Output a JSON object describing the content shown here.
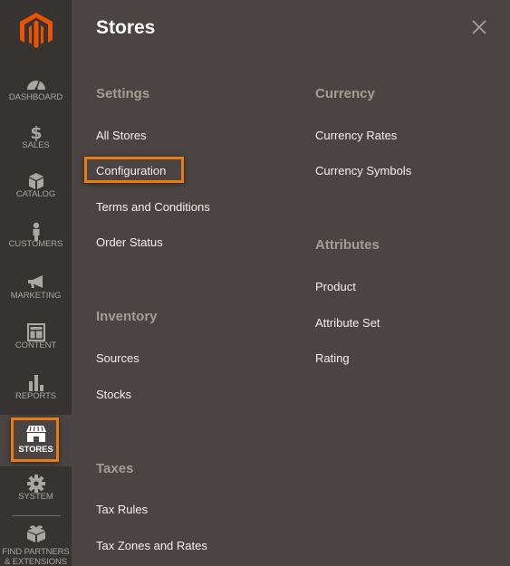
{
  "colors": {
    "sidebar_bg": "#373330",
    "panel_bg": "#4a4542",
    "accent": "#eb7a14",
    "logo": "#eb5202",
    "group_title": "#a49d95",
    "link": "#f2f0ee"
  },
  "sidebar": {
    "logo_icon": "magento-logo",
    "items": [
      {
        "label": "DASHBOARD",
        "icon": "dashboard-gauge-icon"
      },
      {
        "label": "SALES",
        "icon": "dollar-icon"
      },
      {
        "label": "CATALOG",
        "icon": "box-icon"
      },
      {
        "label": "CUSTOMERS",
        "icon": "person-icon"
      },
      {
        "label": "MARKETING",
        "icon": "megaphone-icon"
      },
      {
        "label": "CONTENT",
        "icon": "layout-icon"
      },
      {
        "label": "REPORTS",
        "icon": "bar-chart-icon"
      },
      {
        "label": "STORES",
        "icon": "storefront-icon",
        "active": true
      },
      {
        "label": "SYSTEM",
        "icon": "gear-icon"
      },
      {
        "label": "FIND PARTNERS",
        "label2": "& EXTENSIONS",
        "icon": "lego-brick-icon"
      }
    ]
  },
  "panel": {
    "title": "Stores",
    "close_icon": "close-icon",
    "groups": [
      {
        "title": "Settings",
        "links": [
          "All Stores",
          "Configuration",
          "Terms and Conditions",
          "Order Status"
        ]
      },
      {
        "title": "Inventory",
        "links": [
          "Sources",
          "Stocks"
        ]
      },
      {
        "title": "Taxes",
        "links": [
          "Tax Rules",
          "Tax Zones and Rates"
        ]
      },
      {
        "title": "Currency",
        "links": [
          "Currency Rates",
          "Currency Symbols"
        ]
      },
      {
        "title": "Attributes",
        "links": [
          "Product",
          "Attribute Set",
          "Rating"
        ]
      }
    ],
    "highlighted_link": "Configuration"
  }
}
